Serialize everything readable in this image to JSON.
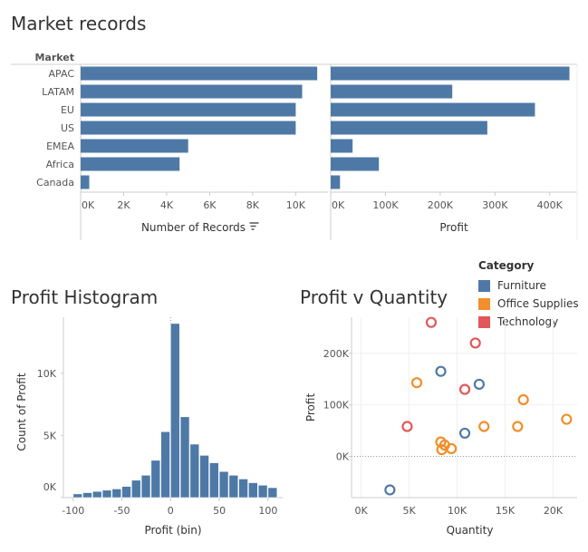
{
  "titles": {
    "market": "Market records",
    "histogram": "Profit Histogram",
    "scatter": "Profit v Quantity"
  },
  "legend": {
    "title": "Category",
    "items": [
      {
        "label": "Furniture",
        "color": "#4e79a7"
      },
      {
        "label": "Office Supplies",
        "color": "#f28e2b"
      },
      {
        "label": "Technology",
        "color": "#e15759"
      }
    ]
  },
  "chart_data": [
    {
      "type": "bar",
      "orientation": "horizontal",
      "row_header": "Market",
      "categories": [
        "APAC",
        "LATAM",
        "EU",
        "US",
        "EMEA",
        "Africa",
        "Canada"
      ],
      "panels": [
        {
          "xlabel": "Number of Records",
          "sort_icon": "sort-descending-icon",
          "xlim": [
            0,
            11500
          ],
          "xticks": [
            0,
            2000,
            4000,
            6000,
            8000,
            10000
          ],
          "xtick_labels": [
            "0K",
            "2K",
            "4K",
            "6K",
            "8K",
            "10K"
          ],
          "values": [
            11000,
            10300,
            10000,
            10000,
            5000,
            4600,
            400
          ]
        },
        {
          "xlabel": "Profit",
          "xlim": [
            0,
            450000
          ],
          "xticks": [
            0,
            100000,
            200000,
            300000,
            400000
          ],
          "xtick_labels": [
            "0K",
            "100K",
            "200K",
            "300K",
            "400K"
          ],
          "values": [
            436000,
            222000,
            373000,
            286000,
            40000,
            88000,
            17000
          ]
        }
      ],
      "color": "#4e79a7"
    },
    {
      "type": "bar",
      "subtype": "histogram",
      "xlabel": "Profit (bin)",
      "ylabel": "Count of Profit",
      "bin_width": 10,
      "bin_starts": [
        -100,
        -90,
        -80,
        -70,
        -60,
        -50,
        -40,
        -30,
        -20,
        -10,
        0,
        10,
        20,
        30,
        40,
        50,
        60,
        70,
        80,
        90,
        100
      ],
      "values": [
        300,
        400,
        500,
        600,
        700,
        900,
        1400,
        1800,
        3000,
        5300,
        14000,
        6500,
        4300,
        3400,
        2800,
        2100,
        1800,
        1500,
        1200,
        1000,
        800
      ],
      "xlim": [
        -110,
        115
      ],
      "ylim": [
        0,
        14500
      ],
      "xticks": [
        -100,
        -50,
        0,
        50,
        100
      ],
      "yticks": [
        0,
        5000,
        10000
      ],
      "ytick_labels": [
        "0K",
        "5K",
        "10K"
      ],
      "color": "#4e79a7"
    },
    {
      "type": "scatter",
      "xlabel": "Quantity",
      "ylabel": "Profit",
      "xlim": [
        -1000,
        22500
      ],
      "ylim": [
        -80000,
        270000
      ],
      "xticks": [
        0,
        5000,
        10000,
        15000,
        20000
      ],
      "xtick_labels": [
        "0K",
        "5K",
        "10K",
        "15K",
        "20K"
      ],
      "yticks": [
        0,
        100000,
        200000
      ],
      "ytick_labels": [
        "0K",
        "100K",
        "200K"
      ],
      "grid": true,
      "series": [
        {
          "name": "Furniture",
          "color": "#4e79a7",
          "points": [
            [
              3000,
              -65000
            ],
            [
              8300,
              165000
            ],
            [
              10800,
              45000
            ],
            [
              12300,
              140000
            ]
          ]
        },
        {
          "name": "Office Supplies",
          "color": "#f28e2b",
          "points": [
            [
              5800,
              143000
            ],
            [
              8300,
              28000
            ],
            [
              8400,
              13000
            ],
            [
              8700,
              22000
            ],
            [
              9400,
              15000
            ],
            [
              12800,
              58000
            ],
            [
              16300,
              58000
            ],
            [
              16900,
              110000
            ],
            [
              21400,
              72000
            ]
          ]
        },
        {
          "name": "Technology",
          "color": "#e15759",
          "points": [
            [
              4800,
              58000
            ],
            [
              7300,
              260000
            ],
            [
              10800,
              130000
            ],
            [
              11900,
              220000
            ]
          ]
        }
      ]
    }
  ]
}
